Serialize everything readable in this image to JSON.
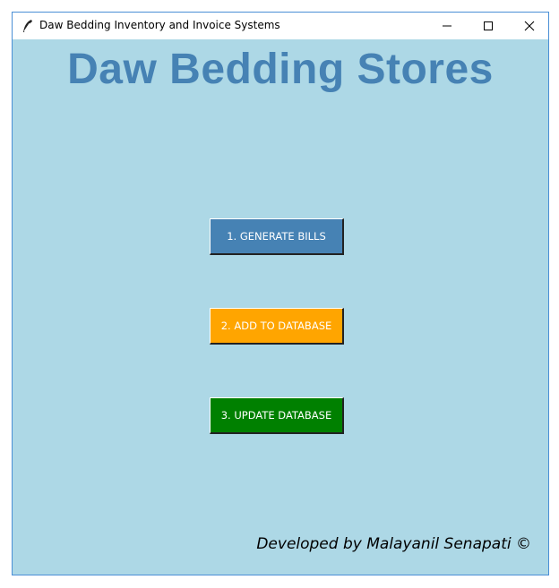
{
  "window": {
    "title": "Daw Bedding Inventory and Invoice Systems",
    "app_icon": "feather-icon",
    "controls": {
      "minimize_icon": "minimize-icon",
      "maximize_icon": "maximize-icon",
      "close_icon": "close-icon"
    }
  },
  "main": {
    "heading": "Daw Bedding Stores",
    "buttons": [
      {
        "label": "1. GENERATE BILLS",
        "color": "#4682b4"
      },
      {
        "label": "2. ADD TO DATABASE",
        "color": "#ffa500"
      },
      {
        "label": "3. UPDATE DATABASE",
        "color": "#008000"
      }
    ],
    "footer": "Developed by Malayanil Senapati ©"
  },
  "colors": {
    "background": "#add8e6",
    "heading": "#4682b4",
    "window_border": "#4a8fd6"
  }
}
